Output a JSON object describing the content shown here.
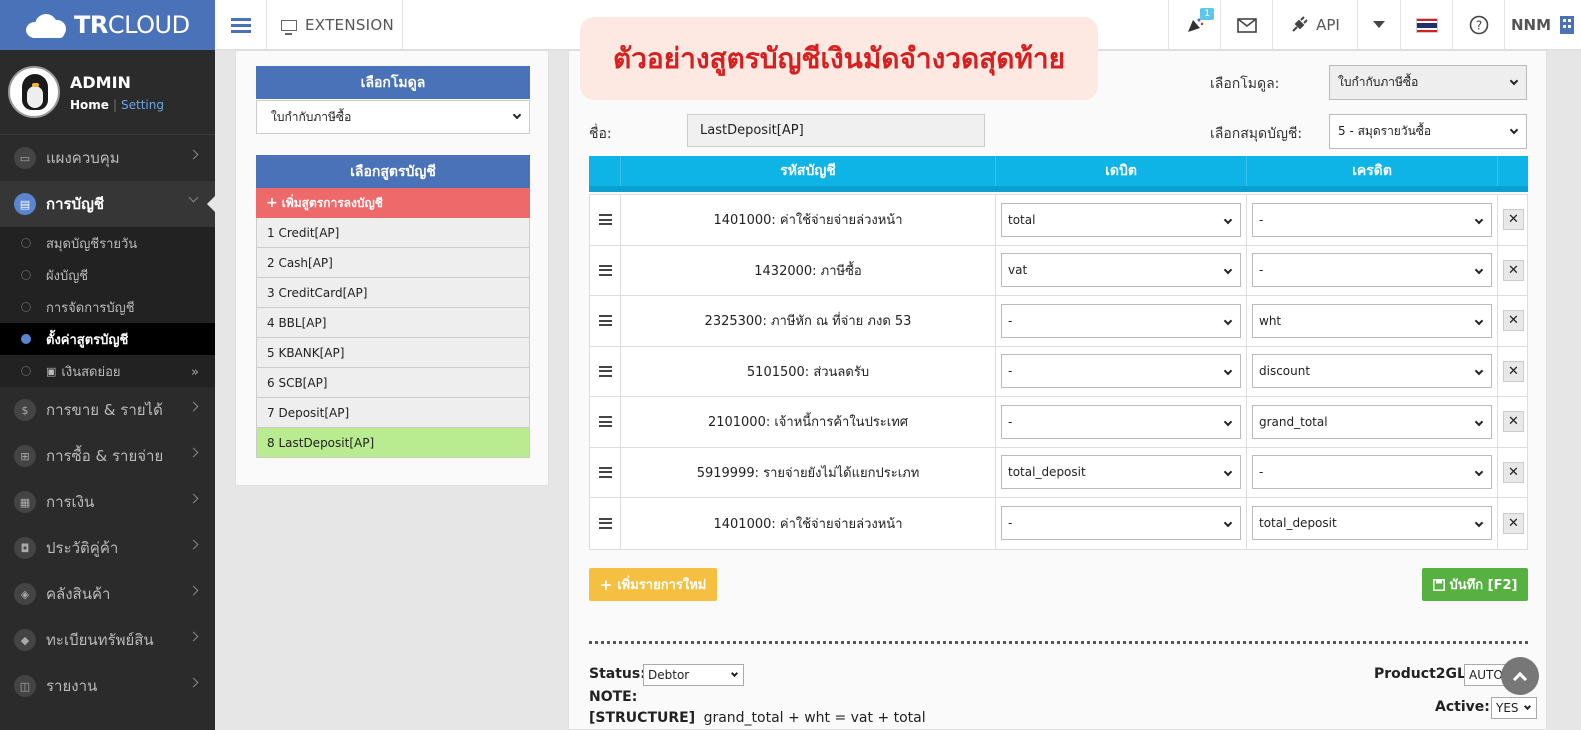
{
  "brand": {
    "bold": "TR",
    "light": "CLOUD"
  },
  "topbar": {
    "extension_label": "EXTENSION",
    "notification_count": "1",
    "api_label": "API",
    "user_label": "NNM"
  },
  "title_banner": "ตัวอย่างสูตรบัญชีเงินมัดจำงวดสุดท้าย",
  "profile": {
    "name": "ADMIN",
    "home": "Home",
    "setting": "Setting"
  },
  "sidebar": {
    "dashboard": "แผงควบคุม",
    "accounting": "การบัญชี",
    "sub": [
      "สมุดบัญชีรายวัน",
      "ผังบัญชี",
      "การจัดการบัญชี",
      "ตั้งค่าสูตรบัญชี",
      "เงินสดย่อย"
    ],
    "sales": "การขาย & รายได้",
    "purchase": "การซื้อ & รายจ่าย",
    "finance": "การเงิน",
    "contacts": "ประวัติคู่ค้า",
    "inventory": "คลังสินค้า",
    "assets": "ทะเบียนทรัพย์สิน",
    "reports": "รายงาน"
  },
  "left_panel": {
    "module_header": "เลือกโมดูล",
    "module_value": "ใบกำกับภาษีซื้อ",
    "formula_header": "เลือกสูตรบัญชี",
    "add_formula": "เพิ่มสูตรการลงบัญชี",
    "formulas": [
      "1 Credit[AP]",
      "2 Cash[AP]",
      "3 CreditCard[AP]",
      "4 BBL[AP]",
      "5 KBANK[AP]",
      "6 SCB[AP]",
      "7 Deposit[AP]",
      "8 LastDeposit[AP]"
    ],
    "selected_index": 7
  },
  "main": {
    "module_label": "เลือกโมดูล:",
    "module_value": "ใบกำกับภาษีซื้อ",
    "name_label": "ชื่อ:",
    "name_value": "LastDeposit[AP]",
    "journal_label": "เลือกสมุดบัญชี:",
    "journal_value": "5 - สมุดรายวันซื้อ",
    "table_headers": {
      "account": "รหัสบัญชี",
      "debit": "เดบิต",
      "credit": "เครดิต"
    },
    "rows": [
      {
        "account": "1401000: ค่าใช้จ่ายจ่ายล่วงหน้า",
        "debit": "total",
        "credit": "-"
      },
      {
        "account": "1432000: ภาษีซื้อ",
        "debit": "vat",
        "credit": "-"
      },
      {
        "account": "2325300: ภาษีหัก ณ ที่จ่าย ภงด 53",
        "debit": "-",
        "credit": "wht"
      },
      {
        "account": "5101500: ส่วนลดรับ",
        "debit": "-",
        "credit": "discount"
      },
      {
        "account": "2101000: เจ้าหนี้การค้าในประเทศ",
        "debit": "-",
        "credit": "grand_total"
      },
      {
        "account": "5919999: รายจ่ายยังไม่ได้แยกประเภท",
        "debit": "total_deposit",
        "credit": "-"
      },
      {
        "account": "1401000: ค่าใช้จ่ายจ่ายล่วงหน้า",
        "debit": "-",
        "credit": "total_deposit"
      }
    ],
    "add_row_label": "เพิ่มรายการใหม่",
    "save_label": "บันทึก [F2]",
    "status_label": "Status:",
    "status_value": "Debtor",
    "note_label": "NOTE:",
    "structure_tag": "[STRUCTURE]",
    "structure_text": "grand_total + wht = vat + total",
    "product2gl_label": "Product2GL:",
    "product2gl_value": "AUTO",
    "active_label": "Active:",
    "active_value": "YES"
  },
  "colors": {
    "brand": "#4a72b8",
    "table_head": "#0fb4e6",
    "add_formula": "#ee6a6a",
    "selected_formula": "#b9ec90",
    "add_row": "#f5c042",
    "save": "#57b140",
    "banner_text": "#d62020"
  }
}
